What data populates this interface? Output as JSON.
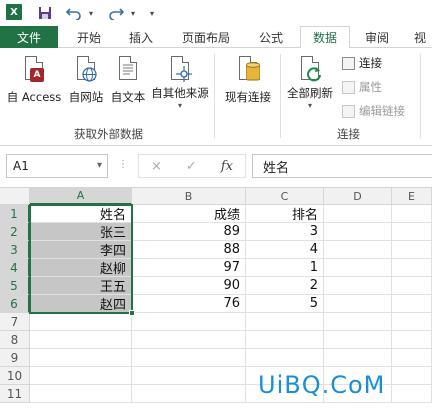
{
  "qat": {
    "logo": "X",
    "save_icon": "save-icon",
    "undo_icon": "undo-icon",
    "redo_icon": "redo-icon",
    "customize_icon": "customize-icon"
  },
  "tabs": [
    {
      "label": "文件"
    },
    {
      "label": "开始"
    },
    {
      "label": "插入"
    },
    {
      "label": "页面布局"
    },
    {
      "label": "公式"
    },
    {
      "label": "数据"
    },
    {
      "label": "审阅"
    },
    {
      "label": "视"
    }
  ],
  "ribbon": {
    "get_external": {
      "buttons": [
        "自 Access",
        "自网站",
        "自文本",
        "自其他来源"
      ],
      "group_label": "获取外部数据"
    },
    "existing_conn": {
      "label": "现有连接"
    },
    "connections": {
      "refresh_label": "全部刷新",
      "items": [
        "连接",
        "属性",
        "编辑链接"
      ],
      "group_label": "连接"
    },
    "accent_color": "#217346"
  },
  "formula_bar": {
    "name_box": "A1",
    "cancel_icon": "×",
    "enter_icon": "✓",
    "fx_label": "fx",
    "formula": "姓名"
  },
  "grid": {
    "columns": [
      "A",
      "B",
      "C",
      "D",
      "E"
    ],
    "rows": [
      "1",
      "2",
      "3",
      "4",
      "5",
      "6",
      "7",
      "8",
      "9",
      "10",
      "11"
    ],
    "data": [
      [
        "姓名",
        "成绩",
        "排名"
      ],
      [
        "张三",
        "89",
        "3"
      ],
      [
        "李四",
        "88",
        "4"
      ],
      [
        "赵柳",
        "97",
        "1"
      ],
      [
        "王五",
        "90",
        "2"
      ],
      [
        "赵四",
        "76",
        "5"
      ]
    ]
  },
  "watermark": "UiBQ.CoM"
}
